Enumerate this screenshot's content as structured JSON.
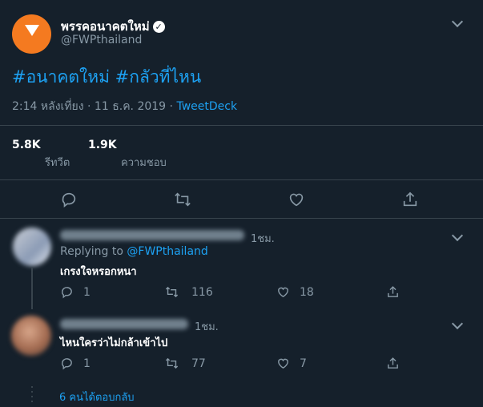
{
  "tweet": {
    "author_name": "พรรคอนาคตใหม่",
    "author_handle": "@FWPthailand",
    "hashtags": "#อนาคตใหม่ #กลัวที่ไหน",
    "time": "2:14 หลังเที่ยง · 11 ธ.ค. 2019 ·",
    "source": "TweetDeck",
    "retweet_count": "5.8K",
    "retweet_label": "รีทวีต",
    "like_count": "1.9K",
    "like_label": "ความชอบ"
  },
  "replies": [
    {
      "time": "1ชม.",
      "replying_prefix": "Replying to",
      "replying_handle": "@FWPthailand",
      "text": "เกรงใจหรอกหนา",
      "reply_count": "1",
      "retweet_count": "116",
      "like_count": "18"
    },
    {
      "time": "1ชม.",
      "text": "ไหนใครว่าไม่กล้าเข้าไป",
      "reply_count": "1",
      "retweet_count": "77",
      "like_count": "7"
    }
  ],
  "more_replies": "6 คนได้ตอบกลับ",
  "colors": {
    "background": "#15202b",
    "accent": "#1da1f2",
    "muted": "#8899a6",
    "divider": "#38444d",
    "brand": "#f47a20"
  }
}
